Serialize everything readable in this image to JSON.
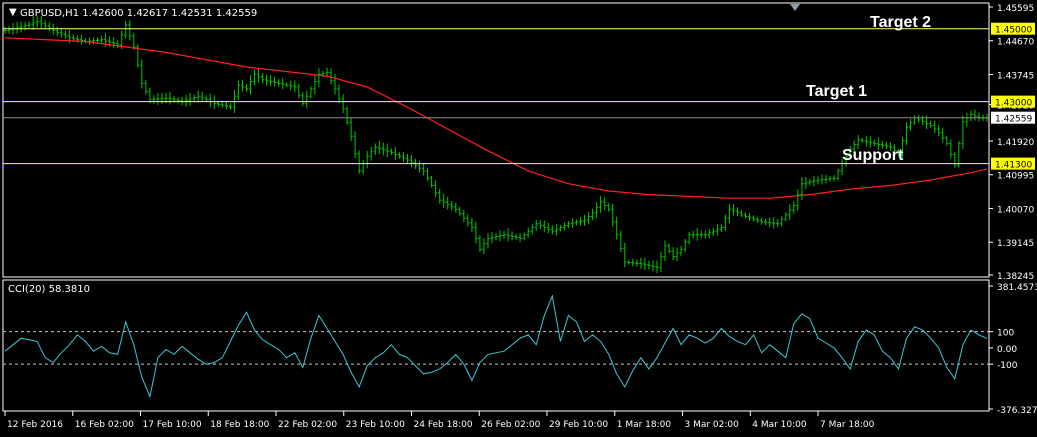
{
  "header": {
    "menu_arrow": "▼",
    "symbol_line": "GBPUSD,H1  1.42600 1.42617 1.42531 1.42559"
  },
  "annotations": {
    "target2": "Target 2",
    "target1": "Target 1",
    "support": "Support"
  },
  "colors": {
    "background": "#000000",
    "axis": "#ffffff",
    "bullish_bar": "#00c800",
    "ma_line": "#ff2020",
    "level_line": "#ffff66",
    "price_line": "#8c8c8c",
    "cci_line": "#3cc8d2",
    "level_tag": "#ffff00"
  },
  "chart_data": [
    {
      "type": "ohlc",
      "symbol": "GBPUSD",
      "timeframe": "H1",
      "last": {
        "open": 1.426,
        "high": 1.42617,
        "low": 1.42531,
        "close": 1.42559
      },
      "ylim": [
        1.38245,
        1.45595
      ],
      "y_ticks": [
        "1.45595",
        "1.44670",
        "1.43745",
        "1.42920",
        "1.41920",
        "1.40995",
        "1.40070",
        "1.39145",
        "1.38245"
      ],
      "x_ticks": [
        "12 Feb 2016",
        "16 Feb 02:00",
        "17 Feb 10:00",
        "18 Feb 18:00",
        "22 Feb 02:00",
        "23 Feb 10:00",
        "24 Feb 18:00",
        "26 Feb 02:00",
        "29 Feb 10:00",
        "1 Mar 18:00",
        "3 Mar 02:00",
        "4 Mar 10:00",
        "7 Mar 18:00"
      ],
      "close_path": [
        [
          0,
          1.4495
        ],
        [
          4,
          1.4505
        ],
        [
          8,
          1.452
        ],
        [
          12,
          1.4495
        ],
        [
          16,
          1.4475
        ],
        [
          20,
          1.4465
        ],
        [
          24,
          1.447
        ],
        [
          28,
          1.4455
        ],
        [
          30,
          1.451
        ],
        [
          32,
          1.445
        ],
        [
          34,
          1.435
        ],
        [
          36,
          1.4305
        ],
        [
          40,
          1.431
        ],
        [
          44,
          1.43
        ],
        [
          48,
          1.4315
        ],
        [
          52,
          1.4295
        ],
        [
          56,
          1.4285
        ],
        [
          58,
          1.4345
        ],
        [
          60,
          1.4335
        ],
        [
          62,
          1.4375
        ],
        [
          64,
          1.436
        ],
        [
          68,
          1.435
        ],
        [
          72,
          1.434
        ],
        [
          74,
          1.4295
        ],
        [
          76,
          1.4335
        ],
        [
          78,
          1.4375
        ],
        [
          80,
          1.438
        ],
        [
          82,
          1.4335
        ],
        [
          84,
          1.428
        ],
        [
          86,
          1.4205
        ],
        [
          88,
          1.411
        ],
        [
          90,
          1.415
        ],
        [
          92,
          1.4175
        ],
        [
          96,
          1.416
        ],
        [
          100,
          1.414
        ],
        [
          104,
          1.411
        ],
        [
          108,
          1.403
        ],
        [
          112,
          1.4005
        ],
        [
          116,
          1.3955
        ],
        [
          118,
          1.3895
        ],
        [
          120,
          1.3925
        ],
        [
          124,
          1.3935
        ],
        [
          128,
          1.3925
        ],
        [
          132,
          1.3965
        ],
        [
          136,
          1.3945
        ],
        [
          140,
          1.3965
        ],
        [
          144,
          1.3975
        ],
        [
          146,
          1.3995
        ],
        [
          148,
          1.4025
        ],
        [
          150,
          1.4005
        ],
        [
          152,
          1.3935
        ],
        [
          154,
          1.386
        ],
        [
          158,
          1.3855
        ],
        [
          162,
          1.3845
        ],
        [
          164,
          1.3905
        ],
        [
          166,
          1.3875
        ],
        [
          168,
          1.3895
        ],
        [
          170,
          1.3935
        ],
        [
          174,
          1.3935
        ],
        [
          178,
          1.3955
        ],
        [
          180,
          1.4005
        ],
        [
          184,
          1.3985
        ],
        [
          188,
          1.397
        ],
        [
          192,
          1.3965
        ],
        [
          196,
          1.4015
        ],
        [
          198,
          1.4075
        ],
        [
          202,
          1.4085
        ],
        [
          206,
          1.409
        ],
        [
          208,
          1.413
        ],
        [
          210,
          1.417
        ],
        [
          212,
          1.4195
        ],
        [
          216,
          1.4185
        ],
        [
          220,
          1.4175
        ],
        [
          222,
          1.4155
        ],
        [
          224,
          1.423
        ],
        [
          226,
          1.4255
        ],
        [
          228,
          1.4245
        ],
        [
          230,
          1.4235
        ],
        [
          232,
          1.4215
        ],
        [
          234,
          1.4185
        ],
        [
          236,
          1.4125
        ],
        [
          238,
          1.4245
        ],
        [
          240,
          1.4265
        ],
        [
          242,
          1.4255
        ],
        [
          244,
          1.42559
        ]
      ],
      "moving_average_path": [
        [
          0,
          1.4475
        ],
        [
          20,
          1.4465
        ],
        [
          40,
          1.4435
        ],
        [
          60,
          1.4395
        ],
        [
          80,
          1.437
        ],
        [
          90,
          1.434
        ],
        [
          100,
          1.4285
        ],
        [
          110,
          1.4225
        ],
        [
          120,
          1.4165
        ],
        [
          130,
          1.411
        ],
        [
          140,
          1.4075
        ],
        [
          150,
          1.4055
        ],
        [
          160,
          1.4045
        ],
        [
          170,
          1.404
        ],
        [
          180,
          1.4035
        ],
        [
          190,
          1.4035
        ],
        [
          200,
          1.4045
        ],
        [
          210,
          1.406
        ],
        [
          220,
          1.407
        ],
        [
          230,
          1.4085
        ],
        [
          240,
          1.4105
        ],
        [
          244,
          1.4115
        ]
      ],
      "horizontal_levels": [
        {
          "name": "Target 2",
          "value": 1.45,
          "label": "1.45000"
        },
        {
          "name": "Target 1",
          "value": 1.43,
          "label": "1.43000"
        },
        {
          "name": "Support",
          "value": 1.413,
          "label": "1.41300"
        }
      ],
      "bid_line": {
        "value": 1.42559,
        "label": "1.42559"
      }
    },
    {
      "type": "line",
      "title": "CCI(20) 58.3810",
      "ylim": [
        -376.3271,
        381.4573
      ],
      "y_ticks": [
        "381.4573",
        "100",
        "0.00",
        "-100",
        "-376.3271"
      ],
      "reference_levels": [
        100,
        -100
      ],
      "values": [
        [
          0,
          -20
        ],
        [
          4,
          60
        ],
        [
          8,
          40
        ],
        [
          10,
          -60
        ],
        [
          12,
          -90
        ],
        [
          14,
          -30
        ],
        [
          16,
          20
        ],
        [
          18,
          80
        ],
        [
          20,
          40
        ],
        [
          22,
          -20
        ],
        [
          24,
          10
        ],
        [
          26,
          -30
        ],
        [
          28,
          -40
        ],
        [
          30,
          160
        ],
        [
          32,
          20
        ],
        [
          34,
          -180
        ],
        [
          36,
          -300
        ],
        [
          38,
          -60
        ],
        [
          40,
          -10
        ],
        [
          42,
          -40
        ],
        [
          44,
          10
        ],
        [
          46,
          -30
        ],
        [
          48,
          -70
        ],
        [
          50,
          -100
        ],
        [
          52,
          -90
        ],
        [
          54,
          -60
        ],
        [
          56,
          40
        ],
        [
          58,
          140
        ],
        [
          60,
          220
        ],
        [
          62,
          110
        ],
        [
          64,
          50
        ],
        [
          66,
          20
        ],
        [
          68,
          -10
        ],
        [
          70,
          -60
        ],
        [
          72,
          -30
        ],
        [
          74,
          -120
        ],
        [
          76,
          60
        ],
        [
          78,
          200
        ],
        [
          80,
          120
        ],
        [
          82,
          40
        ],
        [
          84,
          -40
        ],
        [
          86,
          -150
        ],
        [
          88,
          -240
        ],
        [
          90,
          -110
        ],
        [
          92,
          -60
        ],
        [
          94,
          -30
        ],
        [
          96,
          20
        ],
        [
          98,
          -40
        ],
        [
          100,
          -60
        ],
        [
          102,
          -110
        ],
        [
          104,
          -160
        ],
        [
          106,
          -150
        ],
        [
          108,
          -130
        ],
        [
          110,
          -90
        ],
        [
          112,
          -40
        ],
        [
          114,
          -100
        ],
        [
          116,
          -200
        ],
        [
          118,
          -90
        ],
        [
          120,
          -40
        ],
        [
          124,
          -20
        ],
        [
          128,
          60
        ],
        [
          130,
          80
        ],
        [
          132,
          20
        ],
        [
          134,
          200
        ],
        [
          136,
          320
        ],
        [
          138,
          40
        ],
        [
          140,
          200
        ],
        [
          142,
          160
        ],
        [
          144,
          40
        ],
        [
          146,
          80
        ],
        [
          148,
          40
        ],
        [
          150,
          -40
        ],
        [
          152,
          -160
        ],
        [
          154,
          -240
        ],
        [
          156,
          -140
        ],
        [
          158,
          -60
        ],
        [
          160,
          -130
        ],
        [
          162,
          -60
        ],
        [
          164,
          30
        ],
        [
          166,
          120
        ],
        [
          168,
          20
        ],
        [
          170,
          80
        ],
        [
          172,
          60
        ],
        [
          174,
          30
        ],
        [
          176,
          60
        ],
        [
          178,
          120
        ],
        [
          180,
          70
        ],
        [
          182,
          40
        ],
        [
          184,
          20
        ],
        [
          186,
          80
        ],
        [
          188,
          -30
        ],
        [
          190,
          20
        ],
        [
          192,
          -20
        ],
        [
          194,
          -60
        ],
        [
          196,
          150
        ],
        [
          198,
          210
        ],
        [
          200,
          180
        ],
        [
          202,
          60
        ],
        [
          204,
          30
        ],
        [
          206,
          0
        ],
        [
          208,
          -60
        ],
        [
          210,
          -130
        ],
        [
          212,
          40
        ],
        [
          214,
          110
        ],
        [
          216,
          80
        ],
        [
          218,
          -20
        ],
        [
          220,
          -60
        ],
        [
          222,
          -130
        ],
        [
          224,
          60
        ],
        [
          226,
          130
        ],
        [
          228,
          110
        ],
        [
          230,
          60
        ],
        [
          232,
          0
        ],
        [
          234,
          -120
        ],
        [
          236,
          -190
        ],
        [
          238,
          20
        ],
        [
          240,
          110
        ],
        [
          242,
          80
        ],
        [
          244,
          58.381
        ]
      ]
    }
  ]
}
